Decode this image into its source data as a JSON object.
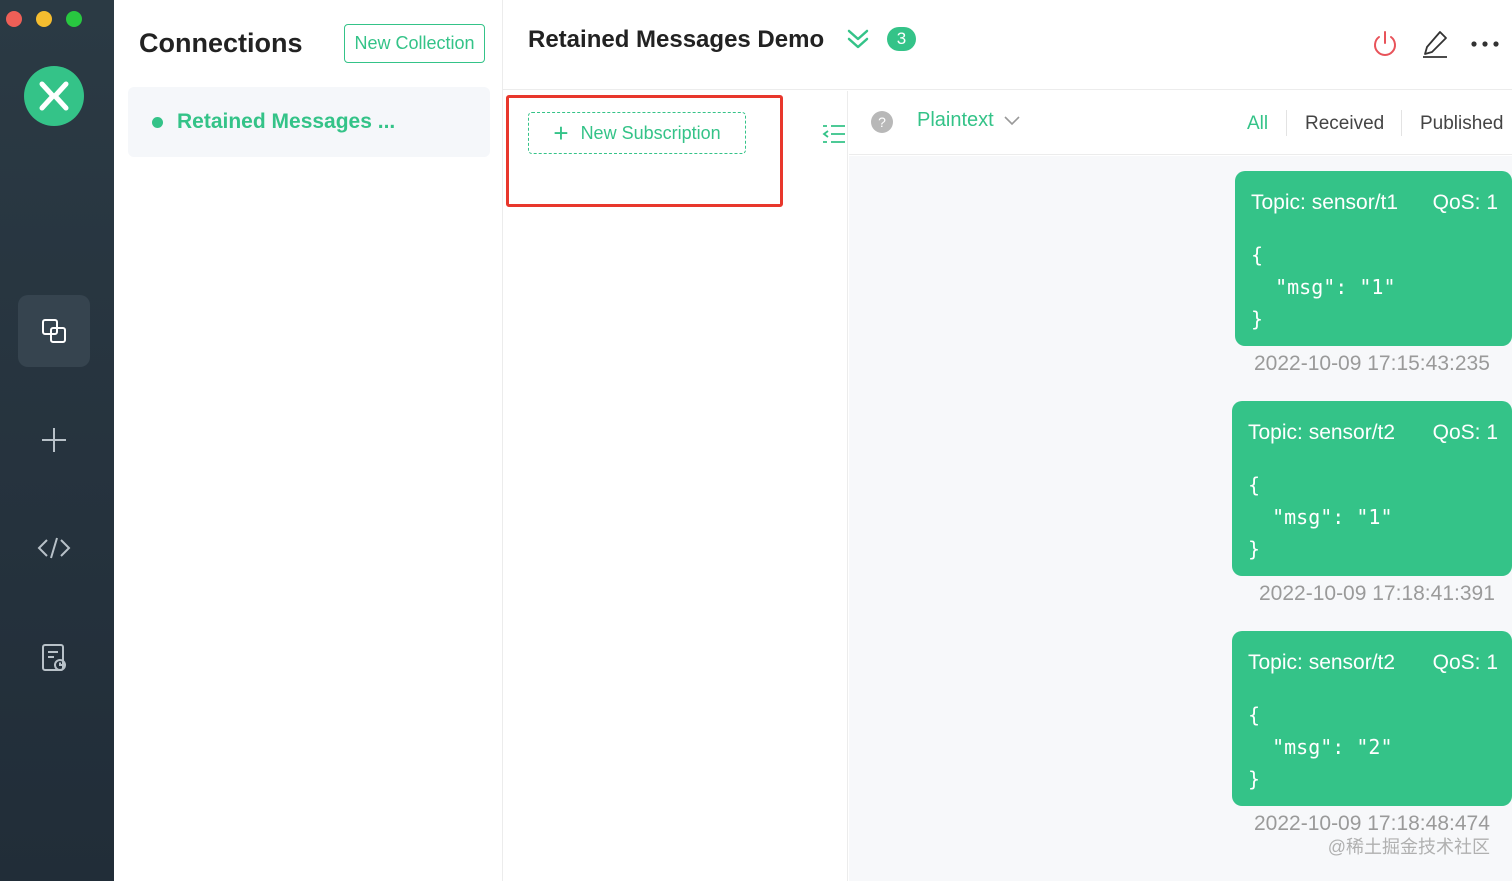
{
  "sidebar": {
    "logo_icon": "mqttx-logo-icon",
    "nav": [
      {
        "name": "connections",
        "icon": "copy-icon",
        "active": true
      },
      {
        "name": "new-connection",
        "icon": "plus-icon",
        "active": false
      },
      {
        "name": "script",
        "icon": "code-icon",
        "active": false
      },
      {
        "name": "log",
        "icon": "log-icon",
        "active": false
      }
    ]
  },
  "connections_panel": {
    "title": "Connections",
    "new_collection_label": "New Collection",
    "items": [
      {
        "name": "Retained Messages ...",
        "status_color": "#34c388"
      }
    ]
  },
  "header": {
    "title": "Retained Messages Demo",
    "unread_count": "3",
    "actions": [
      "power-icon",
      "edit-icon",
      "more-icon"
    ]
  },
  "subscriptions": {
    "new_subscription_label": "New Subscription"
  },
  "messages_toolbar": {
    "help_glyph": "?",
    "payload_type": "Plaintext",
    "filters": {
      "all": "All",
      "received": "Received",
      "published": "Published"
    }
  },
  "messages": [
    {
      "topic": "Topic: sensor/t1",
      "qos": "QoS: 1",
      "payload": "{\n  \"msg\": \"1\"\n}",
      "time": "2022-10-09 17:15:43:235"
    },
    {
      "topic": "Topic: sensor/t2",
      "qos": "QoS: 1",
      "payload": "{\n  \"msg\": \"1\"\n}",
      "time": "2022-10-09 17:18:41:391"
    },
    {
      "topic": "Topic: sensor/t2",
      "qos": "QoS: 1",
      "payload": "{\n  \"msg\": \"2\"\n}",
      "time": "2022-10-09 17:18:48:474"
    }
  ],
  "watermark": "@稀土掘金技术社区",
  "colors": {
    "accent": "#34c388",
    "highlight": "#e8372c",
    "rail": "#2b3a44",
    "power": "#e8535a"
  }
}
